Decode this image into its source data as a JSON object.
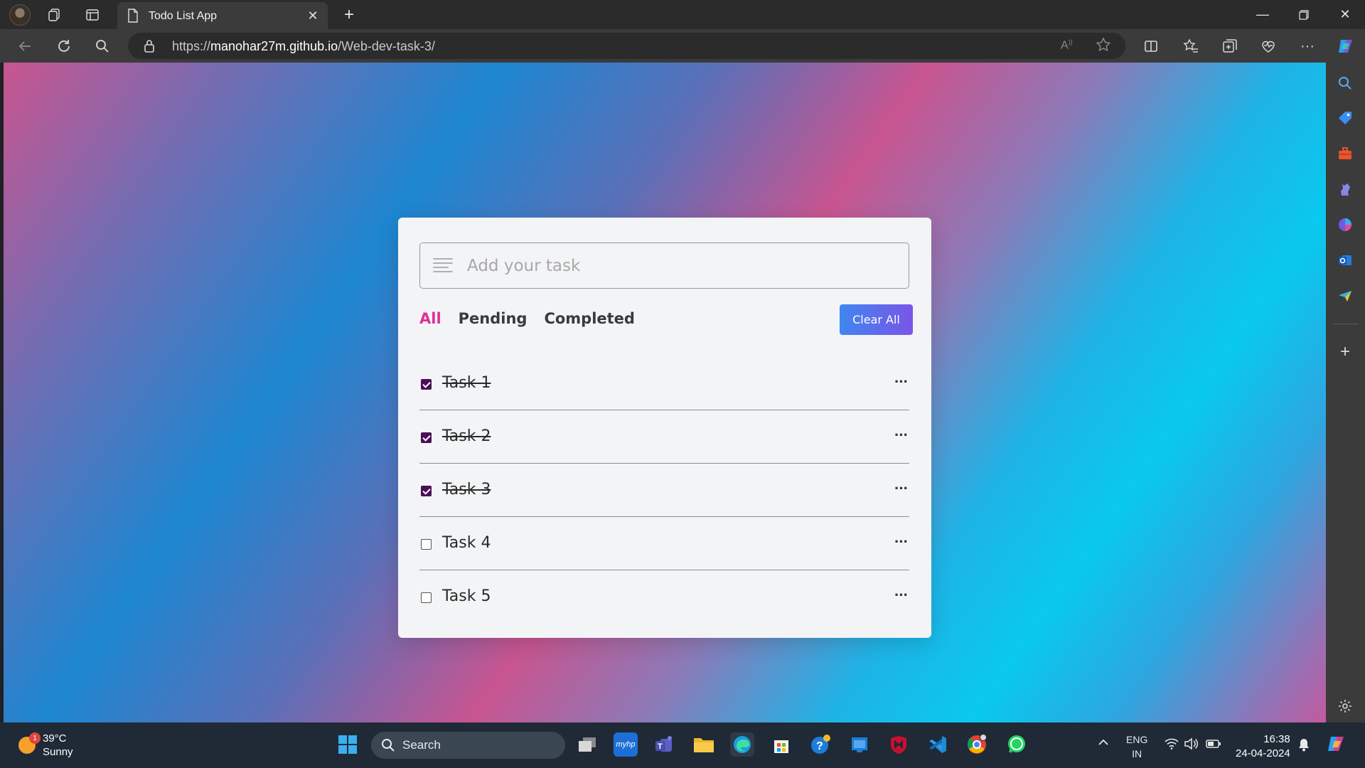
{
  "browser": {
    "tab_title": "Todo List App",
    "url_prefix": "https://",
    "url_host": "manohar27m.github.io",
    "url_path": "/Web-dev-task-3/",
    "new_tab_label": "+"
  },
  "todo": {
    "input_placeholder": "Add your task",
    "filters": [
      "All",
      "Pending",
      "Completed"
    ],
    "active_filter": "All",
    "clear_label": "Clear All",
    "tasks": [
      {
        "name": "Task 1",
        "completed": true
      },
      {
        "name": "Task 2",
        "completed": true
      },
      {
        "name": "Task 3",
        "completed": true
      },
      {
        "name": "Task 4",
        "completed": false
      },
      {
        "name": "Task 5",
        "completed": false
      }
    ],
    "menu_label": "···"
  },
  "taskbar": {
    "weather_temp": "39°C",
    "weather_desc": "Sunny",
    "weather_badge": "1",
    "search_label": "Search",
    "lang_line1": "ENG",
    "lang_line2": "IN",
    "time": "16:38",
    "date": "24-04-2024"
  },
  "colors": {
    "accent_pink": "#e0309a",
    "checkbox_fill": "#4b0f57",
    "button_gradient_start": "#3f86f0",
    "button_gradient_end": "#7a55e8"
  }
}
